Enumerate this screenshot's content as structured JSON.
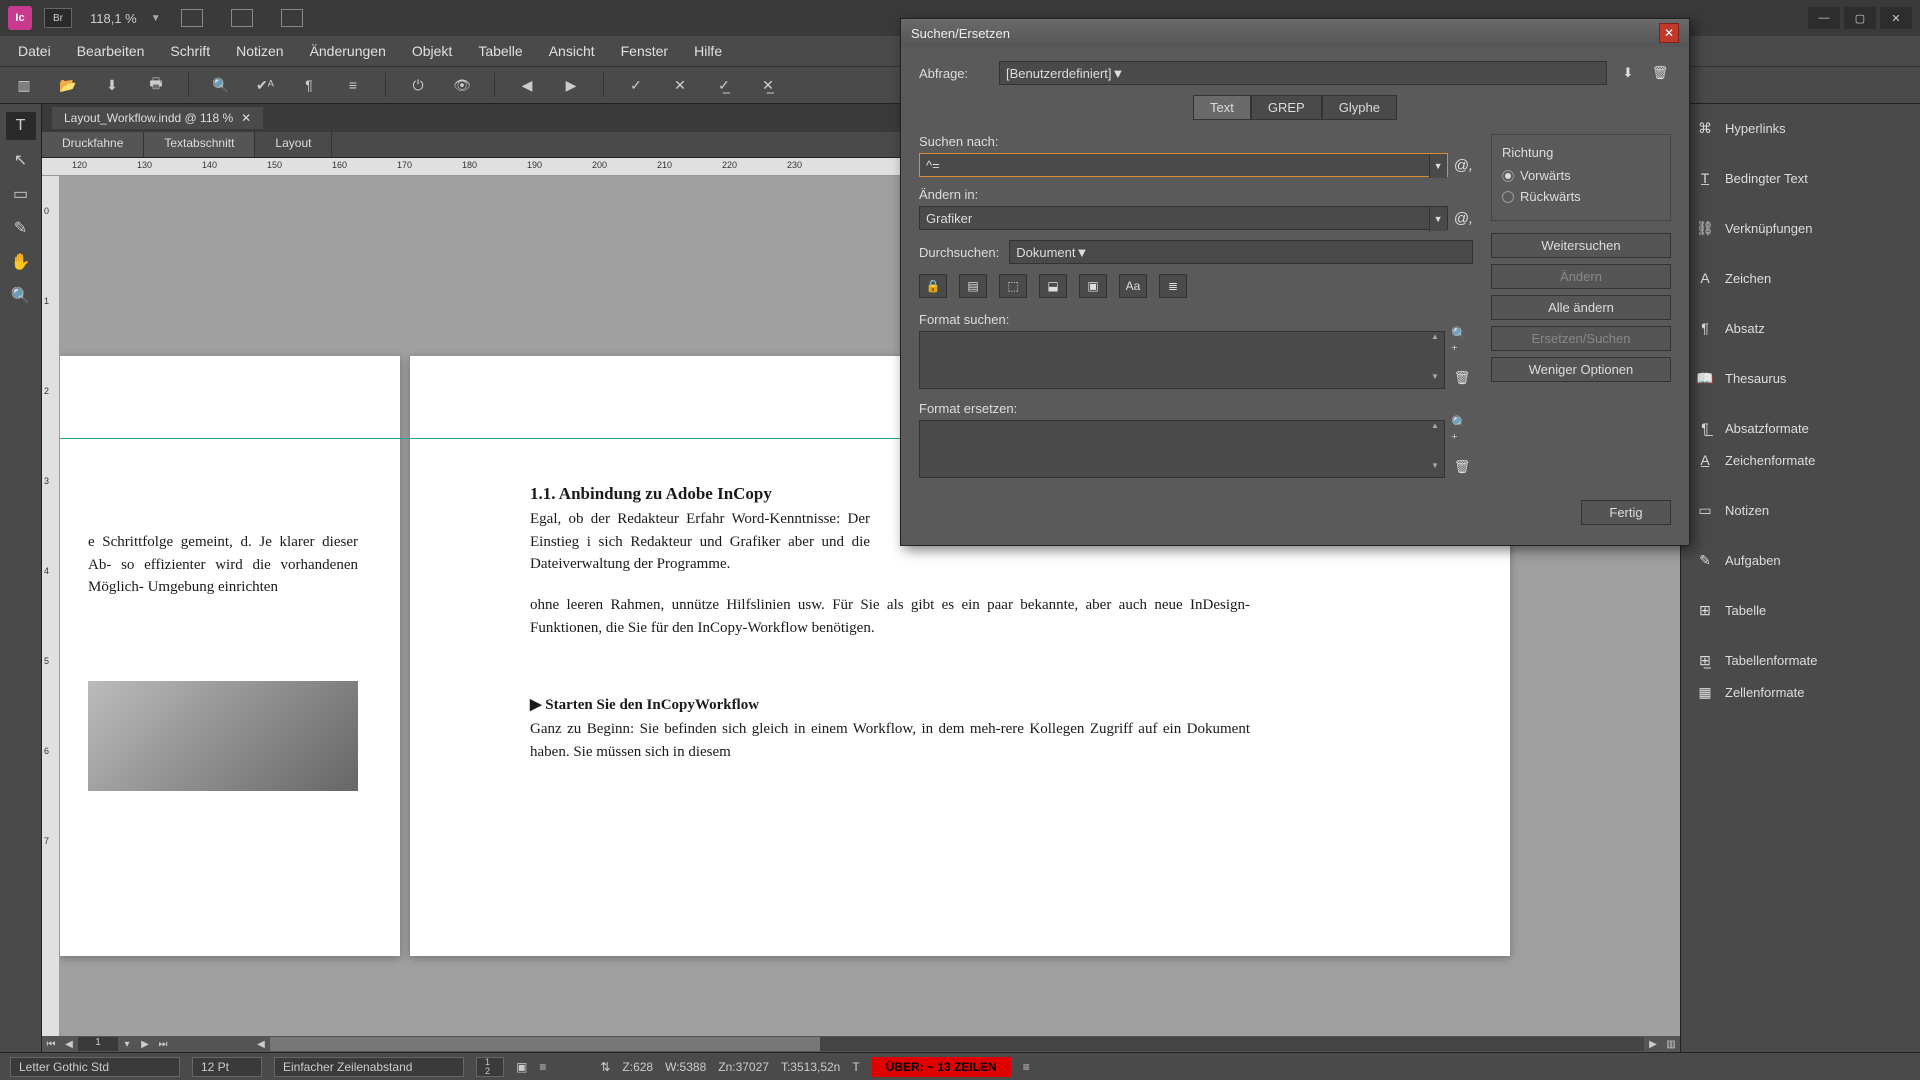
{
  "titlebar": {
    "app": "Ic",
    "br": "Br",
    "zoom": "118,1 %"
  },
  "menu": [
    "Datei",
    "Bearbeiten",
    "Schrift",
    "Notizen",
    "Änderungen",
    "Objekt",
    "Tabelle",
    "Ansicht",
    "Fenster",
    "Hilfe"
  ],
  "doc_tab": "Layout_Workflow.indd @ 118 %",
  "view_tabs": [
    "Druckfahne",
    "Textabschnitt",
    "Layout"
  ],
  "ruler_h": [
    "120",
    "130",
    "140",
    "150",
    "160",
    "170",
    "180",
    "190",
    "200",
    "210",
    "220",
    "230"
  ],
  "ruler_v": [
    "0",
    "1",
    "2",
    "3",
    "4",
    "5",
    "6",
    "7"
  ],
  "page": {
    "h11": "1.1.  Anbindung zu Adobe InCopy",
    "p1": "Egal, ob der Redakteur Erfahr\nWord-Kenntnisse: Der Einstieg i\nsich Redakteur und Grafiker aber\nund die Dateiverwaltung der Programme.",
    "p1b": "ohne leeren Rahmen, unnütze Hilfslinien usw. Für Sie als   gibt es ein paar bekannte, aber auch neue InDesign-Funktionen, die Sie für den InCopy-Workflow benötigen.",
    "lefttxt": "e Schrittfolge gemeint, d. Je klarer dieser Ab- so effizienter wird die vorhandenen Möglich- Umgebung einrichten",
    "h12": "▶  Starten Sie den InCopyWorkflow",
    "p2": "Ganz zu Beginn: Sie befinden sich gleich in einem Workflow, in dem meh-rere Kollegen Zugriff auf ein Dokument haben. Sie müssen sich in diesem"
  },
  "page_nav": {
    "field": "1"
  },
  "panels": [
    "Hyperlinks",
    "Bedingter Text",
    "Verknüpfungen",
    "Zeichen",
    "Absatz",
    "Thesaurus",
    "Absatzformate",
    "Zeichenformate",
    "Notizen",
    "Aufgaben",
    "Tabelle",
    "Tabellenformate",
    "Zellenformate"
  ],
  "status": {
    "font": "Letter Gothic Std",
    "size": "12 Pt",
    "leading": "Einfacher Zeilenabstand",
    "frac": "1\n2",
    "z": "Z:628",
    "w": "W:5388",
    "zn": "Zn:37027",
    "t": "T:3513,52n",
    "over": "ÜBER:  ~ 13 ZEILEN"
  },
  "dialog": {
    "title": "Suchen/Ersetzen",
    "abfrage_lbl": "Abfrage:",
    "abfrage_val": "[Benutzerdefiniert]",
    "tabs": [
      "Text",
      "GREP",
      "Glyphe"
    ],
    "suchen_lbl": "Suchen nach:",
    "suchen_val": "^=",
    "aendern_lbl": "Ändern in:",
    "aendern_val": "Grafiker",
    "durch_lbl": "Durchsuchen:",
    "durch_val": "Dokument",
    "fmt_such": "Format suchen:",
    "fmt_ers": "Format ersetzen:",
    "richtung": "Richtung",
    "vor": "Vorwärts",
    "rueck": "Rückwärts",
    "btn_weiter": "Weitersuchen",
    "btn_aendern": "Ändern",
    "btn_alle": "Alle ändern",
    "btn_ers": "Ersetzen/Suchen",
    "btn_opt": "Weniger Optionen",
    "btn_fertig": "Fertig"
  }
}
